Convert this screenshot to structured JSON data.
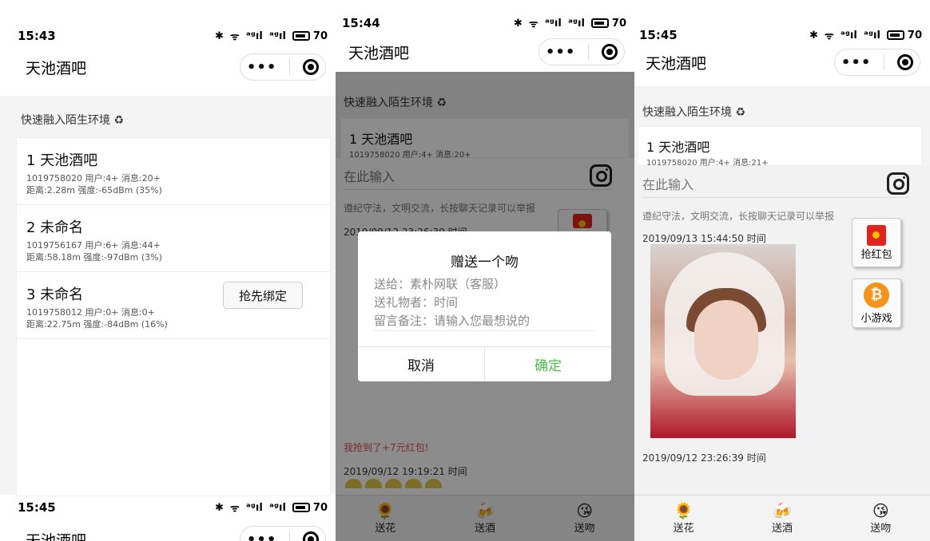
{
  "panel1": {
    "status": {
      "time": "15:43",
      "signal1": "ᵃᵍıl",
      "signal2": "ᵃᵍıl",
      "battery": "70"
    },
    "app_title": "天池酒吧",
    "section_title": "快速融入陌生环境 ♻",
    "rooms": [
      {
        "name": "1 天池酒吧",
        "info": "1019758020 用户:4+ 消息:20+",
        "dist": "距离:2.28m 强度:-65dBm (35%)"
      },
      {
        "name": "2 未命名",
        "info": "1019756167 用户:6+ 消息:44+",
        "dist": "距离:58.18m 强度:-97dBm (3%)"
      },
      {
        "name": "3 未命名",
        "info": "1019758012 用户:0+ 消息:0+",
        "dist": "距离:22.75m 强度:-84dBm (16%)",
        "button": "抢先绑定"
      }
    ],
    "status2": {
      "time": "15:45",
      "battery": "70"
    },
    "app_title2": "天池酒吧"
  },
  "panel2": {
    "status": {
      "time": "15:44",
      "battery": "70"
    },
    "app_title": "天池酒吧",
    "section_title": "快速融入陌生环境 ♻",
    "room_name": "1 天池酒吧",
    "room_info": "1019758020 用户:4+ 消息:20+",
    "input_placeholder": "在此输入",
    "rules": "遵纪守法，文明交流，长按聊天记录可以举报",
    "timestamp1": "2019/09/12 23:26:39 时间",
    "red_msg": "我抢到了+7元红包!",
    "timestamp2": "2019/09/12 19:19:21 时间",
    "dialog": {
      "title": "赠送一个吻",
      "to": "送给：素朴网联（客服）",
      "from": "送礼物者：时间",
      "note": "留言备注：请输入您最想说的",
      "cancel": "取消",
      "ok": "确定"
    },
    "tabs": [
      "送花",
      "送酒",
      "送吻"
    ]
  },
  "panel3": {
    "status": {
      "time": "15:45",
      "battery": "70"
    },
    "app_title": "天池酒吧",
    "section_title": "快速融入陌生环境 ♻",
    "room_name": "1 天池酒吧",
    "room_info": "1019758020 用户:4+ 消息:21+",
    "input_placeholder": "在此输入",
    "rules": "遵纪守法，文明交流，长按聊天记录可以举报",
    "timestamp1": "2019/09/13 15:44:50 时间",
    "timestamp2": "2019/09/12 23:26:39 时间",
    "side_buttons": {
      "red_packet": "抢红包",
      "game": "小游戏"
    },
    "tabs": [
      "送花",
      "送酒",
      "送吻"
    ]
  },
  "icons": {
    "bluetooth": "✱",
    "wifi": "ᯤ",
    "flower": "🌻",
    "beer": "🍻",
    "kiss": "😘",
    "bitcoin": "₿"
  }
}
